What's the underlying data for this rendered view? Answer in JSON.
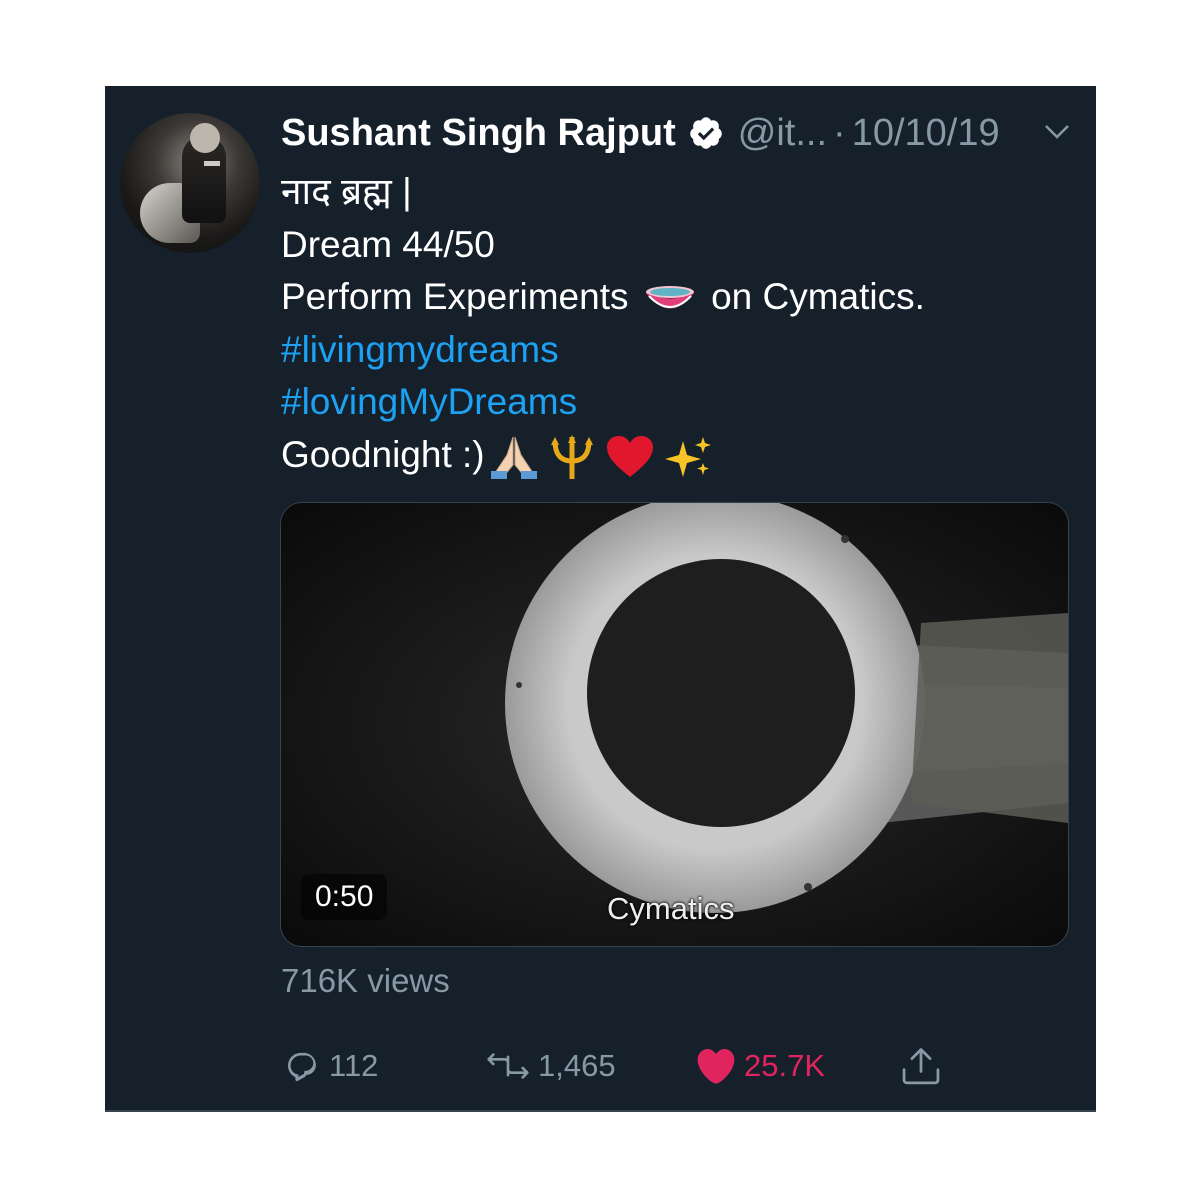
{
  "tweet": {
    "author_name": "Sushant Singh Rajput",
    "handle": "@it...",
    "separator": "·",
    "date": "10/10/19",
    "lines": {
      "l1": "नाद ब्रह्म |",
      "l2": "Dream 44/50",
      "l3_before": "Perform Experiments",
      "l3_after": "on Cymatics.",
      "hashtag1": "#livingmydreams",
      "hashtag2": "#lovingMyDreams",
      "l6": "Goodnight :)"
    },
    "emojis": [
      "bowl-icon",
      "folded-hands-icon",
      "trident-icon",
      "red-heart-icon",
      "sparkles-icon"
    ]
  },
  "media": {
    "duration": "0:50",
    "caption": "Cymatics"
  },
  "stats": {
    "views": "716K views",
    "replies": "112",
    "retweets": "1,465",
    "likes": "25.7K"
  },
  "colors": {
    "background": "#15202b",
    "secondary_text": "#8899a6",
    "link": "#1da1f2",
    "like": "#e0245e"
  }
}
